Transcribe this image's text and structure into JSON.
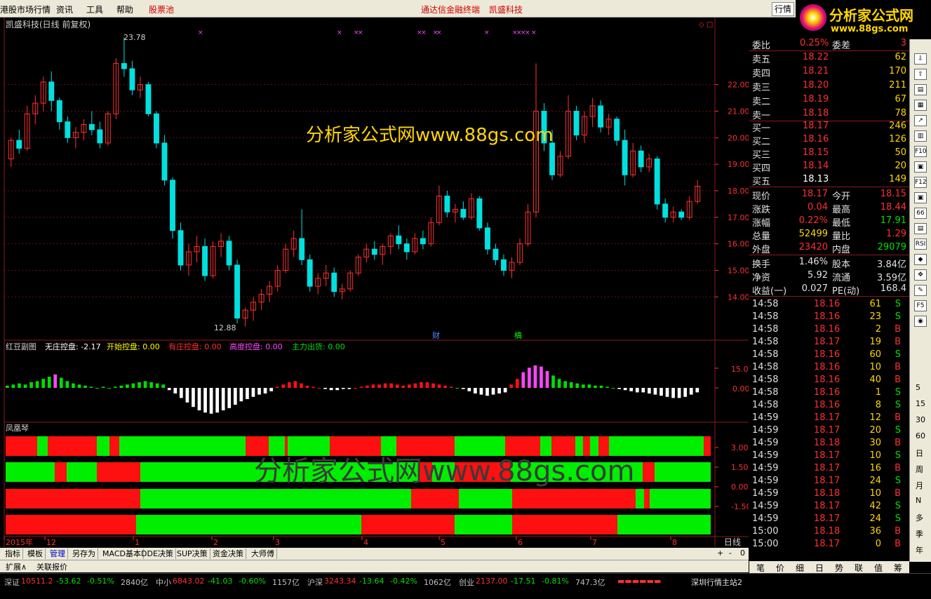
{
  "menu": {
    "items": [
      "港股市场行情",
      "资讯",
      "工具",
      "帮助"
    ],
    "stock_pool": "股票池",
    "app_title": "通达信金融终端",
    "stock_name": "凯盛科技",
    "hq_tab": "行情"
  },
  "brand": {
    "line1": "分析家公式网",
    "line2": "www.88gs.com"
  },
  "main_chart": {
    "title": "凯盛科技(日线 前复权)",
    "watermark": "分析家公式网www.88gs.com",
    "high_label": "23.78",
    "low_label": "12.88",
    "price_ticks": [
      "22.00",
      "21.00",
      "20.00",
      "19.00",
      "18.00",
      "17.00",
      "16.00",
      "15.00",
      "14.00"
    ],
    "price_min": 12.5,
    "price_max": 24.0,
    "event_labels": [
      "财",
      "槁"
    ],
    "candles": [
      [
        19.2,
        20.0,
        18.9,
        19.9
      ],
      [
        19.9,
        20.3,
        19.4,
        19.6
      ],
      [
        19.6,
        21.2,
        19.5,
        20.9
      ],
      [
        20.9,
        21.6,
        20.5,
        21.3
      ],
      [
        21.3,
        22.3,
        21.0,
        22.1
      ],
      [
        22.1,
        22.5,
        21.0,
        21.4
      ],
      [
        21.4,
        21.5,
        20.3,
        20.6
      ],
      [
        20.6,
        20.8,
        19.8,
        20.0
      ],
      [
        20.0,
        20.4,
        19.6,
        20.2
      ],
      [
        20.2,
        20.7,
        19.9,
        20.5
      ],
      [
        20.5,
        21.0,
        20.1,
        20.3
      ],
      [
        20.3,
        20.6,
        19.6,
        19.8
      ],
      [
        19.8,
        21.0,
        19.7,
        20.9
      ],
      [
        20.9,
        23.0,
        20.7,
        22.8
      ],
      [
        22.8,
        23.78,
        22.3,
        22.6
      ],
      [
        22.6,
        22.9,
        21.6,
        21.8
      ],
      [
        21.8,
        22.3,
        21.5,
        22.0
      ],
      [
        22.0,
        22.1,
        20.8,
        20.9
      ],
      [
        20.9,
        21.0,
        19.6,
        19.8
      ],
      [
        19.8,
        20.1,
        18.2,
        18.4
      ],
      [
        18.4,
        18.5,
        16.2,
        16.5
      ],
      [
        16.5,
        16.8,
        15.0,
        15.2
      ],
      [
        15.2,
        16.0,
        14.8,
        15.7
      ],
      [
        15.7,
        16.3,
        15.3,
        15.9
      ],
      [
        15.9,
        16.2,
        14.6,
        14.8
      ],
      [
        14.8,
        16.1,
        14.7,
        15.9
      ],
      [
        15.9,
        16.4,
        15.5,
        16.1
      ],
      [
        16.1,
        16.3,
        15.0,
        15.2
      ],
      [
        15.2,
        15.4,
        13.0,
        13.2
      ],
      [
        13.2,
        13.6,
        12.88,
        13.5
      ],
      [
        13.5,
        14.0,
        13.1,
        13.8
      ],
      [
        13.8,
        14.3,
        13.5,
        14.1
      ],
      [
        14.1,
        14.6,
        13.8,
        14.4
      ],
      [
        14.4,
        15.2,
        14.2,
        15.0
      ],
      [
        15.0,
        16.0,
        14.9,
        15.8
      ],
      [
        15.8,
        16.5,
        15.5,
        16.2
      ],
      [
        16.2,
        17.3,
        15.2,
        15.4
      ],
      [
        15.4,
        15.6,
        14.2,
        14.4
      ],
      [
        14.4,
        14.9,
        14.1,
        14.7
      ],
      [
        14.7,
        15.2,
        14.4,
        14.9
      ],
      [
        14.9,
        15.1,
        14.0,
        14.2
      ],
      [
        14.2,
        14.5,
        13.9,
        14.3
      ],
      [
        14.3,
        15.0,
        14.2,
        14.9
      ],
      [
        14.9,
        15.6,
        14.8,
        15.5
      ],
      [
        15.5,
        16.0,
        15.3,
        15.8
      ],
      [
        15.8,
        16.1,
        15.4,
        15.6
      ],
      [
        15.6,
        16.0,
        15.2,
        15.9
      ],
      [
        15.9,
        16.4,
        15.6,
        16.3
      ],
      [
        16.3,
        16.7,
        15.8,
        16.0
      ],
      [
        16.0,
        16.2,
        15.4,
        15.7
      ],
      [
        15.7,
        16.4,
        15.6,
        16.2
      ],
      [
        16.2,
        16.5,
        15.8,
        16.0
      ],
      [
        16.0,
        17.0,
        15.9,
        16.8
      ],
      [
        16.8,
        18.2,
        16.7,
        17.8
      ],
      [
        17.8,
        18.0,
        17.0,
        17.2
      ],
      [
        17.2,
        17.5,
        16.8,
        17.3
      ],
      [
        17.3,
        17.6,
        16.9,
        17.0
      ],
      [
        17.0,
        17.9,
        16.9,
        17.7
      ],
      [
        17.7,
        17.8,
        16.5,
        16.6
      ],
      [
        16.6,
        16.8,
        15.6,
        15.8
      ],
      [
        15.8,
        16.0,
        15.2,
        15.4
      ],
      [
        15.4,
        15.6,
        14.8,
        15.0
      ],
      [
        15.0,
        15.5,
        14.7,
        15.3
      ],
      [
        15.3,
        16.2,
        15.2,
        16.0
      ],
      [
        16.0,
        17.5,
        15.9,
        17.2
      ],
      [
        17.2,
        22.8,
        17.0,
        21.0
      ],
      [
        21.0,
        21.3,
        19.5,
        19.8
      ],
      [
        19.8,
        20.3,
        18.4,
        18.6
      ],
      [
        18.6,
        19.5,
        18.5,
        19.3
      ],
      [
        19.3,
        21.6,
        19.2,
        21.0
      ],
      [
        21.0,
        21.2,
        19.9,
        20.1
      ],
      [
        20.1,
        21.0,
        19.8,
        20.8
      ],
      [
        20.8,
        21.5,
        20.4,
        21.2
      ],
      [
        21.2,
        21.4,
        20.2,
        20.4
      ],
      [
        20.4,
        20.9,
        20.1,
        20.7
      ],
      [
        20.7,
        20.8,
        19.7,
        19.9
      ],
      [
        19.9,
        20.3,
        18.2,
        18.6
      ],
      [
        18.6,
        19.8,
        18.5,
        19.5
      ],
      [
        19.5,
        19.7,
        18.7,
        18.9
      ],
      [
        18.9,
        19.4,
        18.7,
        19.2
      ],
      [
        19.2,
        19.3,
        17.3,
        17.5
      ],
      [
        17.5,
        17.7,
        16.8,
        17.0
      ],
      [
        17.0,
        17.4,
        16.8,
        17.2
      ],
      [
        17.2,
        17.3,
        16.9,
        17.0
      ],
      [
        17.0,
        17.8,
        16.9,
        17.6
      ],
      [
        17.6,
        18.4,
        17.5,
        18.17
      ]
    ]
  },
  "indicator1": {
    "title": "红豆副图",
    "items": [
      {
        "label": "无庄控盘: -2.17",
        "color": "#ffffff"
      },
      {
        "label": "开始控盘: 0.00",
        "color": "#ffff00"
      },
      {
        "label": "有庄控盘: 0.00",
        "color": "#ff3030"
      },
      {
        "label": "高度控盘: 0.00",
        "color": "#ff44ff"
      },
      {
        "label": "主力出货: 0.00",
        "color": "#00e000"
      }
    ],
    "ticks": [
      "15.00",
      "0.00"
    ],
    "values": [
      2,
      3,
      4,
      3,
      5,
      6,
      8,
      10,
      12,
      9,
      6,
      4,
      3,
      2,
      1,
      0,
      1,
      0,
      1,
      2,
      3,
      4,
      5,
      6,
      5,
      4,
      3,
      -2,
      -5,
      -9,
      -13,
      -17,
      -20,
      -22,
      -23,
      -22,
      -20,
      -18,
      -15,
      -12,
      -10,
      -8,
      -6,
      -5,
      -3,
      1,
      3,
      5,
      6,
      4,
      2,
      1,
      0,
      -1,
      -2,
      -2,
      -1,
      -1,
      0,
      1,
      2,
      3,
      3,
      4,
      4,
      3,
      2,
      3,
      4,
      5,
      5,
      4,
      3,
      2,
      1,
      0,
      -1,
      -3,
      -5,
      -6,
      -7,
      -6,
      -5,
      -4,
      3,
      8,
      14,
      18,
      20,
      19,
      15,
      11,
      8,
      6,
      5,
      4,
      3,
      3,
      2,
      2,
      1,
      0,
      -1,
      -2,
      -3,
      -4,
      -4,
      -5,
      -6,
      -7,
      -8,
      -9,
      -9,
      -8,
      -6,
      -4
    ]
  },
  "indicator2": {
    "title": "凤凰琴",
    "ticks": [
      "3.00",
      "1.50",
      "0.00",
      "-1.50"
    ],
    "rows": [
      [
        [
          0,
          45,
          "r"
        ],
        [
          45,
          60,
          "g"
        ],
        [
          60,
          130,
          "r"
        ],
        [
          130,
          148,
          "g"
        ],
        [
          148,
          162,
          "r"
        ],
        [
          162,
          342,
          "g"
        ],
        [
          342,
          375,
          "r"
        ],
        [
          375,
          398,
          "g"
        ],
        [
          398,
          402,
          "r"
        ],
        [
          402,
          462,
          "g"
        ],
        [
          462,
          535,
          "r"
        ],
        [
          535,
          557,
          "g"
        ],
        [
          557,
          640,
          "r"
        ],
        [
          640,
          712,
          "g"
        ],
        [
          712,
          762,
          "r"
        ],
        [
          762,
          778,
          "g"
        ],
        [
          778,
          812,
          "r"
        ],
        [
          812,
          823,
          "g"
        ],
        [
          823,
          833,
          "r"
        ],
        [
          833,
          845,
          "g"
        ],
        [
          845,
          860,
          "r"
        ],
        [
          860,
          995,
          "g"
        ],
        [
          995,
          1005,
          "r"
        ]
      ],
      [
        [
          0,
          70,
          "g"
        ],
        [
          70,
          87,
          "r"
        ],
        [
          87,
          130,
          "g"
        ],
        [
          130,
          192,
          "r"
        ],
        [
          192,
          590,
          "g"
        ],
        [
          590,
          608,
          "r"
        ],
        [
          608,
          640,
          "g"
        ],
        [
          640,
          720,
          "r"
        ],
        [
          720,
          908,
          "g"
        ],
        [
          908,
          925,
          "r"
        ],
        [
          925,
          1005,
          "g"
        ]
      ],
      [
        [
          0,
          192,
          "r"
        ],
        [
          192,
          578,
          "g"
        ],
        [
          578,
          646,
          "r"
        ],
        [
          646,
          722,
          "g"
        ],
        [
          722,
          898,
          "r"
        ],
        [
          898,
          910,
          "g"
        ],
        [
          910,
          918,
          "r"
        ],
        [
          918,
          1005,
          "g"
        ]
      ],
      [
        [
          0,
          186,
          "r"
        ],
        [
          186,
          507,
          "g"
        ],
        [
          507,
          640,
          "r"
        ],
        [
          640,
          722,
          "g"
        ],
        [
          722,
          872,
          "r"
        ],
        [
          872,
          1005,
          "g"
        ]
      ]
    ]
  },
  "x_axis": {
    "labels": [
      "2015年",
      "12",
      "1",
      "2",
      "3",
      "4",
      "5",
      "6",
      "7",
      "8"
    ],
    "period": "日线"
  },
  "bottom_tabs": [
    "指标",
    "模板",
    "管理",
    "另存为",
    "MACD基本",
    "DDE决策",
    "SUP决策",
    "资金决策",
    "大师傅"
  ],
  "ext_row": [
    "扩展∧",
    "关联报价"
  ],
  "quote": {
    "wb": {
      "label": "委比",
      "value": "0.25%",
      "label2": "委差",
      "value2": "3"
    },
    "asks": [
      {
        "label": "卖五",
        "price": "18.22",
        "vol": "62"
      },
      {
        "label": "卖四",
        "price": "18.21",
        "vol": "170"
      },
      {
        "label": "卖三",
        "price": "18.20",
        "vol": "211"
      },
      {
        "label": "卖二",
        "price": "18.19",
        "vol": "67"
      },
      {
        "label": "卖一",
        "price": "18.18",
        "vol": "78"
      }
    ],
    "bids": [
      {
        "label": "买一",
        "price": "18.17",
        "vol": "246"
      },
      {
        "label": "买二",
        "price": "18.16",
        "vol": "126"
      },
      {
        "label": "买三",
        "price": "18.15",
        "vol": "50"
      },
      {
        "label": "买四",
        "price": "18.14",
        "vol": "20"
      },
      {
        "label": "买五",
        "price": "18.13",
        "vol": "149"
      }
    ],
    "stats": [
      {
        "l1": "现价",
        "v1": "18.17",
        "l2": "今开",
        "v2": "18.15",
        "c1": "up",
        "c2": "up"
      },
      {
        "l1": "涨跌",
        "v1": "0.04",
        "l2": "最高",
        "v2": "18.44",
        "c1": "up",
        "c2": "up"
      },
      {
        "l1": "涨幅",
        "v1": "0.22%",
        "l2": "最低",
        "v2": "17.91",
        "c1": "up",
        "c2": "dn"
      },
      {
        "l1": "总量",
        "v1": "52499",
        "l2": "量比",
        "v2": "1.29",
        "c1": "yl",
        "c2": "up"
      },
      {
        "l1": "外盘",
        "v1": "23420",
        "l2": "内盘",
        "v2": "29079",
        "c1": "up",
        "c2": "dn"
      }
    ],
    "stats2": [
      {
        "l1": "换手",
        "v1": "1.46%",
        "l2": "股本",
        "v2": "3.84亿"
      },
      {
        "l1": "净资",
        "v1": "5.92",
        "l2": "流通",
        "v2": "3.59亿"
      },
      {
        "l1": "收益(一)",
        "v1": "0.027",
        "l2": "PE(动)",
        "v2": "168.4"
      }
    ],
    "ticks": [
      [
        "14:58",
        "18.16",
        "61",
        "S"
      ],
      [
        "14:58",
        "18.16",
        "23",
        "S"
      ],
      [
        "14:58",
        "18.16",
        "2",
        "B"
      ],
      [
        "14:58",
        "18.17",
        "19",
        "B"
      ],
      [
        "14:58",
        "18.16",
        "60",
        "S"
      ],
      [
        "14:58",
        "18.16",
        "10",
        "B"
      ],
      [
        "14:58",
        "18.16",
        "40",
        "B"
      ],
      [
        "14:58",
        "18.16",
        "1",
        "S"
      ],
      [
        "14:58",
        "18.16",
        "8",
        "S"
      ],
      [
        "14:59",
        "18.17",
        "12",
        "B"
      ],
      [
        "14:59",
        "18.17",
        "20",
        "S"
      ],
      [
        "14:59",
        "18.18",
        "30",
        "B"
      ],
      [
        "14:59",
        "18.17",
        "10",
        "S"
      ],
      [
        "14:59",
        "18.17",
        "16",
        "B"
      ],
      [
        "14:59",
        "18.17",
        "24",
        "S"
      ],
      [
        "14:59",
        "18.18",
        "10",
        "B"
      ],
      [
        "14:59",
        "18.17",
        "42",
        "S"
      ],
      [
        "14:59",
        "18.17",
        "24",
        "S"
      ],
      [
        "15:00",
        "18.18",
        "36",
        "B"
      ],
      [
        "15:00",
        "18.17",
        "0",
        "B"
      ]
    ]
  },
  "right_tabs": [
    "笔",
    "价",
    "细",
    "日",
    "势",
    "联",
    "值",
    "筹"
  ],
  "sidebar": {
    "icons": [
      "⇩",
      "⇧",
      "▤",
      "▦",
      "↗",
      "▥",
      "F10",
      "▣",
      "F12",
      "▣",
      "66",
      "▤",
      "RSI",
      "◆",
      "✥",
      "✎",
      "F5",
      "◉"
    ],
    "texts": [
      "5",
      "15",
      "30",
      "60",
      "日",
      "周",
      "月",
      "N",
      "多",
      "季",
      "年"
    ]
  },
  "status": {
    "items": [
      {
        "name": "深证",
        "val": "10511.2",
        "chg": "-53.62",
        "pct": "-0.51%",
        "amt": "2840亿"
      },
      {
        "name": "中小",
        "val": "6843.02",
        "chg": "-41.03",
        "pct": "-0.60%",
        "amt": "1157亿"
      },
      {
        "name": "沪深",
        "val": "3243.34",
        "chg": "-13.64",
        "pct": "-0.42%",
        "amt": "1062亿"
      },
      {
        "name": "创业",
        "val": "2137.00",
        "chg": "-17.51",
        "pct": "-0.81%",
        "amt": "747.3亿"
      }
    ],
    "server": "深圳行情主站2"
  },
  "colors": {
    "up": "#ff3030",
    "down": "#00e0e0",
    "green": "#00ee00",
    "red": "#ff1010",
    "grid": "#7a1010"
  }
}
